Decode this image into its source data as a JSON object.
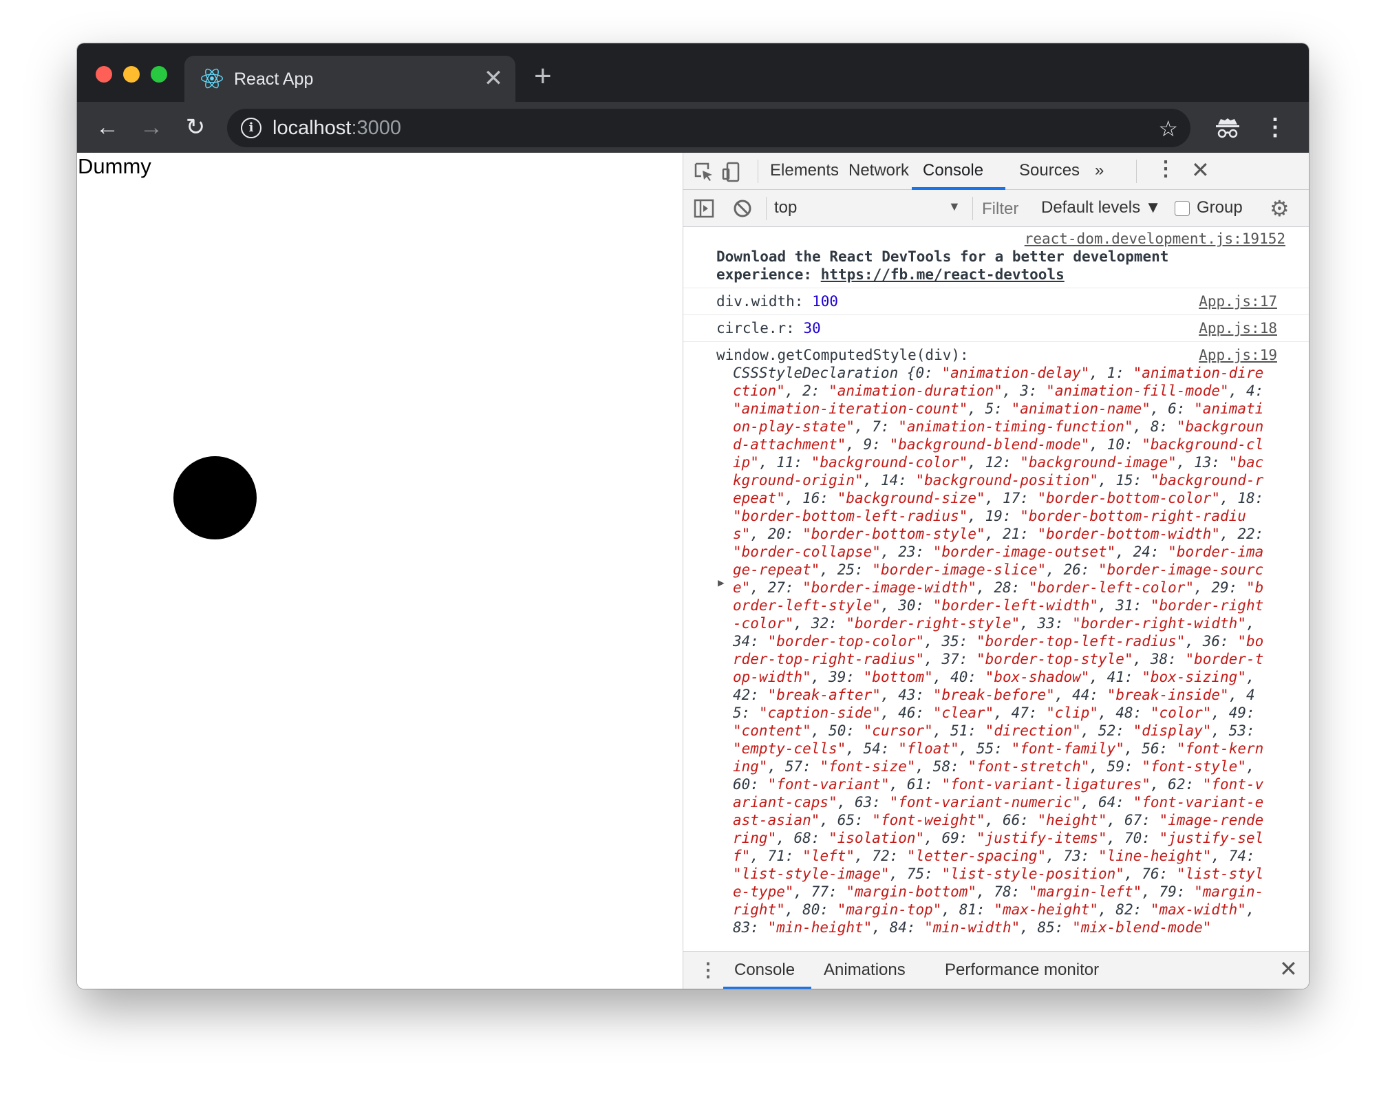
{
  "browser": {
    "tab_title": "React App",
    "tab_close": "✕",
    "new_tab": "+",
    "url_host": "localhost",
    "url_port": ":3000",
    "back": "←",
    "forward": "→",
    "reload": "↻",
    "star": "☆",
    "menu": "⋮"
  },
  "page": {
    "text": "Dummy"
  },
  "devtools": {
    "tabs": [
      "Elements",
      "Network",
      "Console",
      "Sources"
    ],
    "active_tab": "Console",
    "more_tabs": "»",
    "filter_bar": {
      "context": "top",
      "filter_placeholder": "Filter",
      "levels": "Default levels ▼",
      "group_label": "Group"
    },
    "messages": [
      {
        "source": "react-dom.development.js:19152",
        "text_line1": "Download the React DevTools for a better development",
        "text_line2_prefix": "experience: ",
        "link": "https://fb.me/react-devtools"
      },
      {
        "label": "div.width: ",
        "value": "100",
        "source": "App.js:17"
      },
      {
        "label": "circle.r: ",
        "value": "30",
        "source": "App.js:18"
      },
      {
        "label": "window.getComputedStyle(div):",
        "source": "App.js:19",
        "object_text": "CSSStyleDeclaration {0: \"animation-delay\", 1: \"animation-direction\", 2: \"animation-duration\", 3: \"animation-fill-mode\", 4: \"animation-iteration-count\", 5: \"animation-name\", 6: \"animation-play-state\", 7: \"animation-timing-function\", 8: \"background-attachment\", 9: \"background-blend-mode\", 10: \"background-clip\", 11: \"background-color\", 12: \"background-image\", 13: \"background-origin\", 14: \"background-position\", 15: \"background-repeat\", 16: \"background-size\", 17: \"border-bottom-color\", 18: \"border-bottom-left-radius\", 19: \"border-bottom-right-radius\", 20: \"border-bottom-style\", 21: \"border-bottom-width\", 22: \"border-collapse\", 23: \"border-image-outset\", 24: \"border-image-repeat\", 25: \"border-image-slice\", 26: \"border-image-source\", 27: \"border-image-width\", 28: \"border-left-color\", 29: \"border-left-style\", 30: \"border-left-width\", 31: \"border-right-color\", 32: \"border-right-style\", 33: \"border-right-width\", 34: \"border-top-color\", 35: \"border-top-left-radius\", 36: \"border-top-right-radius\", 37: \"border-top-style\", 38: \"border-top-width\", 39: \"bottom\", 40: \"box-shadow\", 41: \"box-sizing\", 42: \"break-after\", 43: \"break-before\", 44: \"break-inside\", 45: \"caption-side\", 46: \"clear\", 47: \"clip\", 48: \"color\", 49: \"content\", 50: \"cursor\", 51: \"direction\", 52: \"display\", 53: \"empty-cells\", 54: \"float\", 55: \"font-family\", 56: \"font-kerning\", 57: \"font-size\", 58: \"font-stretch\", 59: \"font-style\", 60: \"font-variant\", 61: \"font-variant-ligatures\", 62: \"font-variant-caps\", 63: \"font-variant-numeric\", 64: \"font-variant-east-asian\", 65: \"font-weight\", 66: \"height\", 67: \"image-rendering\", 68: \"isolation\", 69: \"justify-items\", 70: \"justify-self\", 71: \"left\", 72: \"letter-spacing\", 73: \"line-height\", 74: \"list-style-image\", 75: \"list-style-position\", 76: \"list-style-type\", 77: \"margin-bottom\", 78: \"margin-left\", 79: \"margin-right\", 80: \"margin-top\", 81: \"max-height\", 82: \"max-width\", 83: \"min-height\", 84: \"min-width\", 85: \"mix-blend-mode\""
      }
    ],
    "drawer_tabs": [
      "Console",
      "Animations",
      "Performance monitor"
    ]
  },
  "colors": {
    "tab_strip": "#202124",
    "toolbar": "#35363a",
    "accent": "#1a73e8",
    "string": "#c41a16",
    "number": "#1c00cf"
  }
}
